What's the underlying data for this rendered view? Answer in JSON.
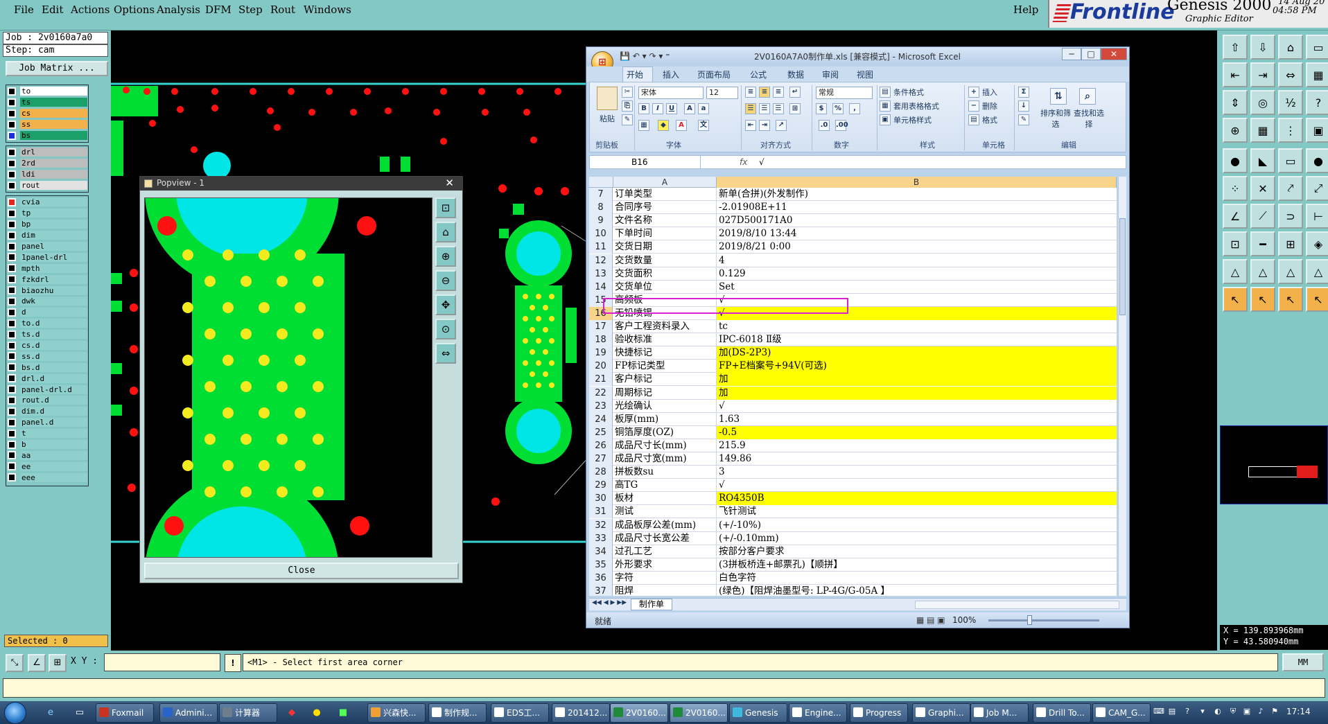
{
  "menubar": {
    "items": [
      "File",
      "Edit",
      "Actions",
      "Options",
      "Analysis",
      "DFM",
      "Step",
      "Rout",
      "Windows"
    ],
    "help": "Help",
    "brand_name": "Frontline",
    "brand_product": "Genesis 2000",
    "brand_sub": "Graphic Editor",
    "brand_date": "14 Aug 20",
    "brand_time": "04:58 PM"
  },
  "left_panel": {
    "job": "Job : 2v0160a7a0",
    "step": "Step: cam",
    "job_matrix": "Job Matrix ...",
    "group1": [
      {
        "name": "to",
        "color": "#ffffff",
        "box": "#000000"
      },
      {
        "name": "ts",
        "color": "#1ca06a",
        "box": "#000000"
      },
      {
        "name": "cs",
        "color": "#f2b14a",
        "box": "#000000"
      },
      {
        "name": "ss",
        "color": "#f2b14a",
        "box": "#000000"
      },
      {
        "name": "bs",
        "color": "#1ca06a",
        "box": "#1a2ee0"
      }
    ],
    "group2": [
      {
        "name": "drl",
        "color": "#bdbdbd"
      },
      {
        "name": "2rd",
        "color": "#bdbdbd"
      },
      {
        "name": "ldi",
        "color": "#bdbdbd"
      },
      {
        "name": "rout",
        "color": "#e2e2e2"
      }
    ],
    "group3": [
      {
        "name": "cvia",
        "box": "#e0261f"
      },
      {
        "name": "tp"
      },
      {
        "name": "bp"
      },
      {
        "name": "dim"
      },
      {
        "name": "panel"
      },
      {
        "name": "1panel-drl"
      },
      {
        "name": "mpth"
      },
      {
        "name": "fzkdrl"
      },
      {
        "name": "biaozhu"
      },
      {
        "name": "dwk"
      },
      {
        "name": "d"
      },
      {
        "name": "to.d"
      },
      {
        "name": "ts.d"
      },
      {
        "name": "cs.d"
      },
      {
        "name": "ss.d"
      },
      {
        "name": "bs.d"
      },
      {
        "name": "drl.d"
      },
      {
        "name": "panel-drl.d"
      },
      {
        "name": "rout.d"
      },
      {
        "name": "dim.d"
      },
      {
        "name": "panel.d"
      },
      {
        "name": "t"
      },
      {
        "name": "b"
      },
      {
        "name": "aa"
      },
      {
        "name": "ee"
      },
      {
        "name": "eee"
      }
    ],
    "selected": "Selected : 0"
  },
  "popview": {
    "title": "Popview - 1",
    "close_x": "✕",
    "close_label": "Close",
    "tools": [
      "zoom-fit-icon",
      "zoom-home-icon",
      "zoom-in-icon",
      "zoom-out-icon",
      "pan-icon",
      "center-icon",
      "measure-icon"
    ]
  },
  "excel": {
    "title": "2V0160A7A0制作单.xls [兼容模式] - Microsoft Excel",
    "office_glyph": "⊞",
    "qat": "💾 ↶ ▾ ↷ ▾ ⁼",
    "win_min": "─",
    "win_max": "□",
    "win_close": "✕",
    "tabs": [
      "开始",
      "插入",
      "页面布局",
      "公式",
      "数据",
      "审阅",
      "视图"
    ],
    "ribbon": {
      "paste": "粘贴",
      "clipboard": "剪贴板",
      "font_name": "宋体",
      "font_size": "12",
      "font": "字体",
      "alignment": "对齐方式",
      "number_format": "常规",
      "number": "数字",
      "cond_format": "条件格式",
      "table_format": "套用表格格式",
      "cell_style": "单元格样式",
      "styles": "样式",
      "insert": "插入",
      "delete": "删除",
      "format": "格式",
      "cells": "单元格",
      "sort_filter": "排序和筛选",
      "find_select": "查找和选择",
      "editing": "编辑",
      "bold": "B",
      "italic": "I",
      "underline": "U",
      "percent": "%"
    },
    "name_box": "B16",
    "fx": "fx",
    "formula_value": "√",
    "col_a": "A",
    "col_b": "B",
    "rows": [
      {
        "n": "7",
        "a": "订单类型",
        "b": "新单(合拼)(外发制作)",
        "hl": false
      },
      {
        "n": "8",
        "a": "合同序号",
        "b": "-2.01908E+11",
        "hl": false
      },
      {
        "n": "9",
        "a": "文件名称",
        "b": "027D500171A0",
        "hl": false
      },
      {
        "n": "10",
        "a": "下单时间",
        "b": "2019/8/10 13:44",
        "hl": false
      },
      {
        "n": "11",
        "a": "交货日期",
        "b": "2019/8/21 0:00",
        "hl": false
      },
      {
        "n": "12",
        "a": "交货数量",
        "b": "4",
        "hl": false
      },
      {
        "n": "13",
        "a": "交货面积",
        "b": "0.129",
        "hl": false
      },
      {
        "n": "14",
        "a": "交货单位",
        "b": "Set",
        "hl": false
      },
      {
        "n": "15",
        "a": "高频板",
        "b": "√",
        "hl": false
      },
      {
        "n": "16",
        "a": "无铅喷锡",
        "b": "√",
        "hl": true
      },
      {
        "n": "17",
        "a": "客户工程资料录入",
        "b": "tc",
        "hl": false
      },
      {
        "n": "18",
        "a": "验收标准",
        "b": "IPC-6018 Ⅱ级",
        "hl": false
      },
      {
        "n": "19",
        "a": "快捷标记",
        "b": "加(DS-2P3)",
        "hl": true
      },
      {
        "n": "20",
        "a": "FP标记类型",
        "b": "FP+E档案号+94V(可选)",
        "hl": true
      },
      {
        "n": "21",
        "a": "客户标记",
        "b": "加",
        "hl": true
      },
      {
        "n": "22",
        "a": "周期标记",
        "b": "加",
        "hl": true
      },
      {
        "n": "23",
        "a": "光绘确认",
        "b": "√",
        "hl": false
      },
      {
        "n": "24",
        "a": "板厚(mm)",
        "b": "1.63",
        "hl": false
      },
      {
        "n": "25",
        "a": "铜箔厚度(OZ)",
        "b": "-0.5",
        "hl": true
      },
      {
        "n": "26",
        "a": "成品尺寸长(mm)",
        "b": "215.9",
        "hl": false
      },
      {
        "n": "27",
        "a": "成品尺寸宽(mm)",
        "b": "149.86",
        "hl": false
      },
      {
        "n": "28",
        "a": "拼板数su",
        "b": "3",
        "hl": false
      },
      {
        "n": "29",
        "a": "高TG",
        "b": "√",
        "hl": false
      },
      {
        "n": "30",
        "a": "板材",
        "b": "RO4350B",
        "hl": true
      },
      {
        "n": "31",
        "a": "测试",
        "b": "飞针测试",
        "hl": false
      },
      {
        "n": "32",
        "a": "成品板厚公差(mm)",
        "b": "(+/-10%)",
        "hl": false
      },
      {
        "n": "33",
        "a": "成品尺寸长宽公差",
        "b": "(+/-0.10mm)",
        "hl": false
      },
      {
        "n": "34",
        "a": "过孔工艺",
        "b": "按部分客户要求",
        "hl": false
      },
      {
        "n": "35",
        "a": "外形要求",
        "b": "(3拼板桥连+邮票孔)【顺拼】",
        "hl": false
      },
      {
        "n": "36",
        "a": "字符",
        "b": "白色字符",
        "hl": false
      },
      {
        "n": "37",
        "a": "阻焊",
        "b": "(绿色)【阻焊油墨型号: LP-4G/G-05A 】",
        "hl": false
      }
    ],
    "sheet_nav": "◀◀ ◀ ▶ ▶▶",
    "sheet_tab": "制作单",
    "status": "就绪",
    "zoom": "100%"
  },
  "right_panel": {
    "x": "X = 139.893968mm",
    "y": "Y = 43.580940mm"
  },
  "cmdbar": {
    "xy_label": "X Y :",
    "bang": "!",
    "message": "<M1> - Select first area corner",
    "units": "MM"
  },
  "taskbar": {
    "buttons": [
      {
        "label": "Foxmail",
        "color": "#c8321f"
      },
      {
        "label": "Admini...",
        "color": "#2a63c8"
      },
      {
        "label": "计算器",
        "color": "#6f7d8c"
      },
      {
        "label": "兴森快...",
        "color": "#f2a033"
      },
      {
        "label": "制作规...",
        "color": "#ffffff"
      },
      {
        "label": "EDS工...",
        "color": "#ffffff"
      },
      {
        "label": "201412...",
        "color": "#ffffff"
      },
      {
        "label": "2V0160...",
        "color": "#1e8a3a"
      },
      {
        "label": "2V0160...",
        "color": "#1e8a3a"
      },
      {
        "label": "Genesis",
        "color": "#3fb8e0"
      },
      {
        "label": "Engine...",
        "color": "#ffffff"
      },
      {
        "label": "Progress",
        "color": "#ffffff"
      },
      {
        "label": "Graphi...",
        "color": "#ffffff"
      },
      {
        "label": "Job M...",
        "color": "#ffffff"
      },
      {
        "label": "Drill To...",
        "color": "#ffffff"
      },
      {
        "label": "CAM_G...",
        "color": "#ffffff"
      }
    ],
    "clock": "17:14"
  }
}
